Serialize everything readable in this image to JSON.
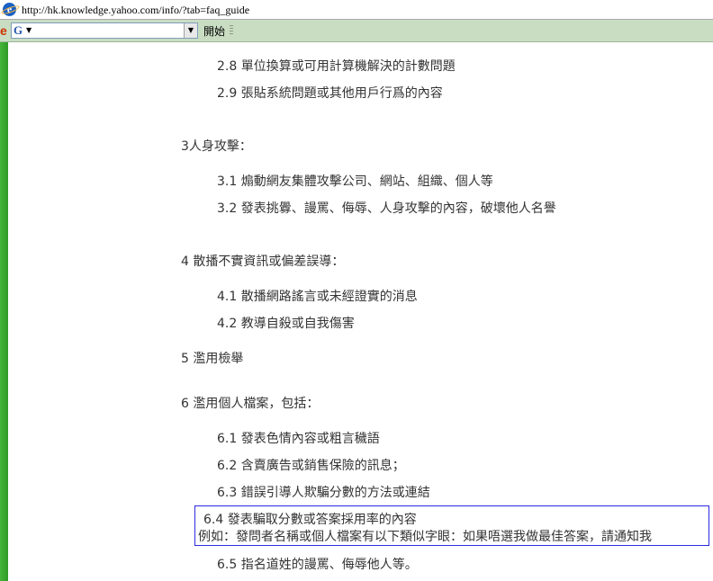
{
  "browser": {
    "address": "http://hk.knowledge.yahoo.com/info/?tab=faq_guide",
    "toolbar_e": "e",
    "search_logo": "G",
    "go_label": "開始"
  },
  "content": {
    "item_2_8": "2.8 單位換算或可用計算機解決的計數問題",
    "item_2_9": "2.9 張貼系統問題或其他用戶行爲的內容",
    "section_3": "3人身攻擊：",
    "item_3_1": "3.1 煽動網友集體攻擊公司、網站、組織、個人等",
    "item_3_2": "3.2 發表挑釁、謾罵、侮辱、人身攻擊的內容，破壞他人名譽",
    "section_4": "4 散播不實資訊或偏差誤導：",
    "item_4_1": "4.1 散播網路謠言或未經證實的消息",
    "item_4_2": "4.2 教導自殺或自我傷害",
    "section_5": "5 濫用檢舉",
    "section_6": "6 濫用個人檔案，包括：",
    "item_6_1": "6.1 發表色情內容或粗言穢語",
    "item_6_2": "6.2 含賣廣告或銷售保險的訊息；",
    "item_6_3": "6.3 錯誤引導人欺騙分數的方法或連結",
    "item_6_4": "6.4 發表騙取分數或答案採用率的內容",
    "item_6_4_example": "例如：發問者名稱或個人檔案有以下類似字眼：如果唔選我做最佳答案，請通知我",
    "item_6_5": "6.5 指名道姓的謾罵、侮辱他人等。"
  },
  "colors": {
    "highlight_border": "#2a2ae0",
    "toolbar_bg": "#c9ddc3",
    "left_strip": "#3aa930"
  }
}
